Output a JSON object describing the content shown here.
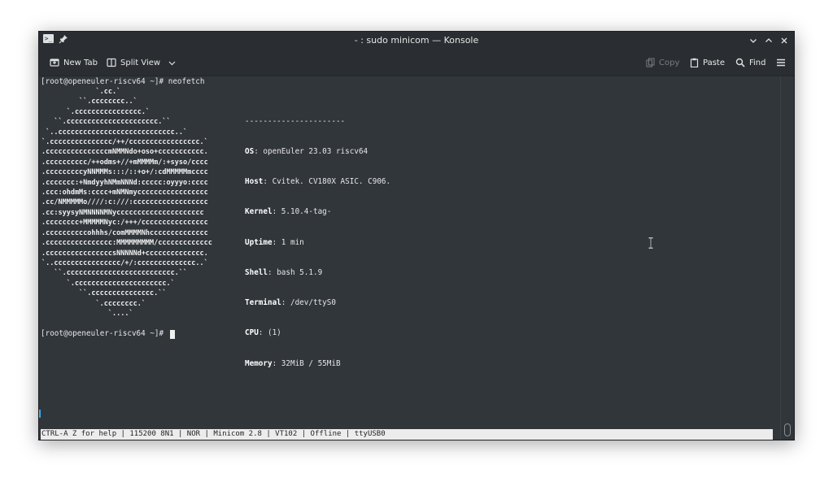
{
  "window": {
    "title": "- : sudo minicom — Konsole",
    "icons": [
      "terminal-app-icon",
      "pin-icon",
      "minimize-icon",
      "maximize-icon",
      "close-icon"
    ]
  },
  "toolbar": {
    "new_tab": "New Tab",
    "split_view": "Split View",
    "copy": "Copy",
    "paste": "Paste",
    "find": "Find"
  },
  "terminal": {
    "prompt_line": "[root@openeuler-riscv64 ~]# neofetch",
    "ascii_logo": "             `.cc.`\n         ``.cccccccc..`\n      `.cccccccccccccccc.`\n   ``.cccccccccccccccccccccc.``\n `..cccccccccccccccccccccccccccc..`\n`.ccccccccccccccc/++/ccccccccccccccccc.`\n.cccccccccccccccmNMMNdo+oso+ccccccccccc.\n.cccccccccc/++odms+//+mMMMMm/:+syso/cccc\n.cccccccccyNNMMMs:::/::+o+/:cdMMMMMmcccc\n.ccccccc:+NmdyyhNMmNNNd:ccccc:oyyyo:cccc\n.ccc:ohdmMs:cccc+mNMNmyccccccccccccccccc\n.cc/NMMMMMo////:c:///:cccccccccccccccccc\n.cc:syysyNMNNNNMNyccccccccccccccccccccc\n.cccccccc+MMMMMNyc:/+++/cccccccccccccccc\n.ccccccccccohhhs/comMMMMNhcccccccccccccc\n.cccccccccccccccc:MMMMMMMMM/ccccccccccccc\n.ccccccccccccccccsNNNNNd+cccccccccccccc.\n`..cccccccccccccccc/+/:cccccccccccccc..`\n   ``.cccccccccccccccccccccccccc.``\n      `.cccccccccccccccccccccc.`\n         ``.ccccccccccccccc.``\n             `.cccccccc.`\n                `....`",
    "info_separator": "----------------------",
    "info": [
      {
        "key": "OS",
        "value": ": openEuler 23.03 riscv64"
      },
      {
        "key": "Host",
        "value": ": Cvitek. CV180X ASIC. C906."
      },
      {
        "key": "Kernel",
        "value": ": 5.10.4-tag-"
      },
      {
        "key": "Uptime",
        "value": ": 1 min"
      },
      {
        "key": "Shell",
        "value": ": bash 5.1.9"
      },
      {
        "key": "Terminal",
        "value": ": /dev/ttyS0"
      },
      {
        "key": "CPU",
        "value": ": (1)"
      },
      {
        "key": "Memory",
        "value": ": 32MiB / 55MiB"
      }
    ],
    "prompt_current": "[root@openeuler-riscv64 ~]# "
  },
  "status_bar": "CTRL-A Z for help | 115200 8N1 | NOR | Minicom 2.8 | VT102 | Offline | ttyUSB0"
}
